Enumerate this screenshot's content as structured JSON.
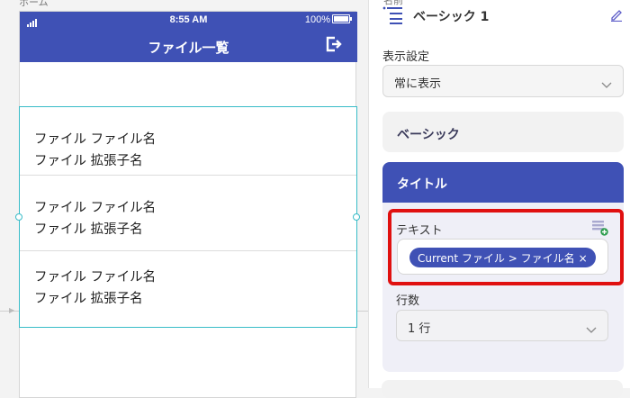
{
  "canvas": {
    "screen_label": "ホーム",
    "status_bar": {
      "time": "8:55 AM",
      "battery": "100%"
    },
    "app_bar": {
      "title": "ファイル一覧",
      "exit_icon": "exit-icon"
    },
    "list_items": [
      {
        "line1": "ファイル ファイル名",
        "line2": "ファイル 拡張子名"
      },
      {
        "line1": "ファイル ファイル名",
        "line2": "ファイル 拡張子名"
      },
      {
        "line1": "ファイル ファイル名",
        "line2": "ファイル 拡張子名"
      }
    ]
  },
  "panel": {
    "top_label": "名前",
    "component_name": "ベーシック 1",
    "display_setting": {
      "label": "表示設定",
      "value": "常に表示"
    },
    "basic_card": {
      "title": "ベーシック"
    },
    "title_card": {
      "header": "タイトル",
      "text_label": "テキスト",
      "chip_text": "Current ファイル > ファイル名",
      "chip_close": "×",
      "lines_label": "行数",
      "lines_value": "1 行"
    }
  },
  "colors": {
    "brand": "#3f51b5",
    "selection": "#38bcc8",
    "highlight": "#e01010"
  }
}
